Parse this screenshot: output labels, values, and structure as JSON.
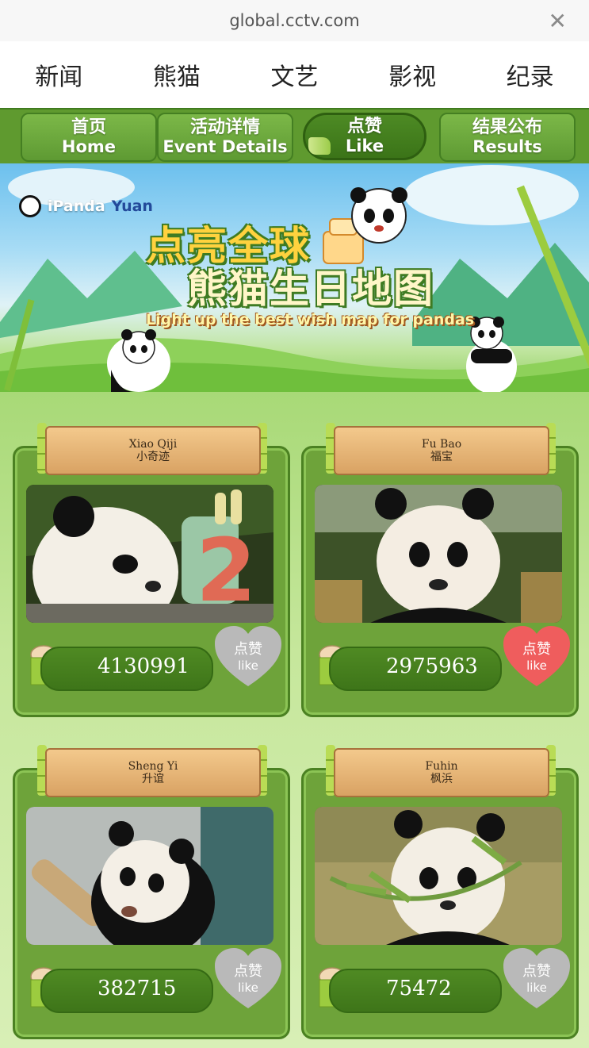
{
  "browser": {
    "url": "global.cctv.com",
    "close_glyph": "✕"
  },
  "site_nav": [
    "新闻",
    "熊猫",
    "文艺",
    "影视",
    "纪录"
  ],
  "tabs": [
    {
      "zh": "首页",
      "en": "Home"
    },
    {
      "zh": "活动详情",
      "en": "Event Details"
    },
    {
      "zh": "点赞",
      "en": "Like"
    },
    {
      "zh": "结果公布",
      "en": "Results"
    }
  ],
  "banner": {
    "brand_ipanda": "iPanda",
    "brand_yuan": "Yuan",
    "title_line1": "点亮全球",
    "title_line2": "熊猫生日地图",
    "subtitle": "Light up the best wish map for pandas"
  },
  "like_label_zh": "点赞",
  "like_label_en": "like",
  "pandas": [
    {
      "name_en": "Xiao Qiji",
      "name_zh": "小奇迹",
      "votes": "4130991",
      "liked": false
    },
    {
      "name_en": "Fu Bao",
      "name_zh": "福宝",
      "votes": "2975963",
      "liked": true
    },
    {
      "name_en": "Sheng Yi",
      "name_zh": "升谊",
      "votes": "382715",
      "liked": false
    },
    {
      "name_en": "Fuhin",
      "name_zh": "枫浜",
      "votes": "75472",
      "liked": false
    }
  ],
  "colors": {
    "liked_heart": "#ef5d5d",
    "unliked_heart": "#b9b9b9",
    "accent_green": "#5f9a2f"
  }
}
